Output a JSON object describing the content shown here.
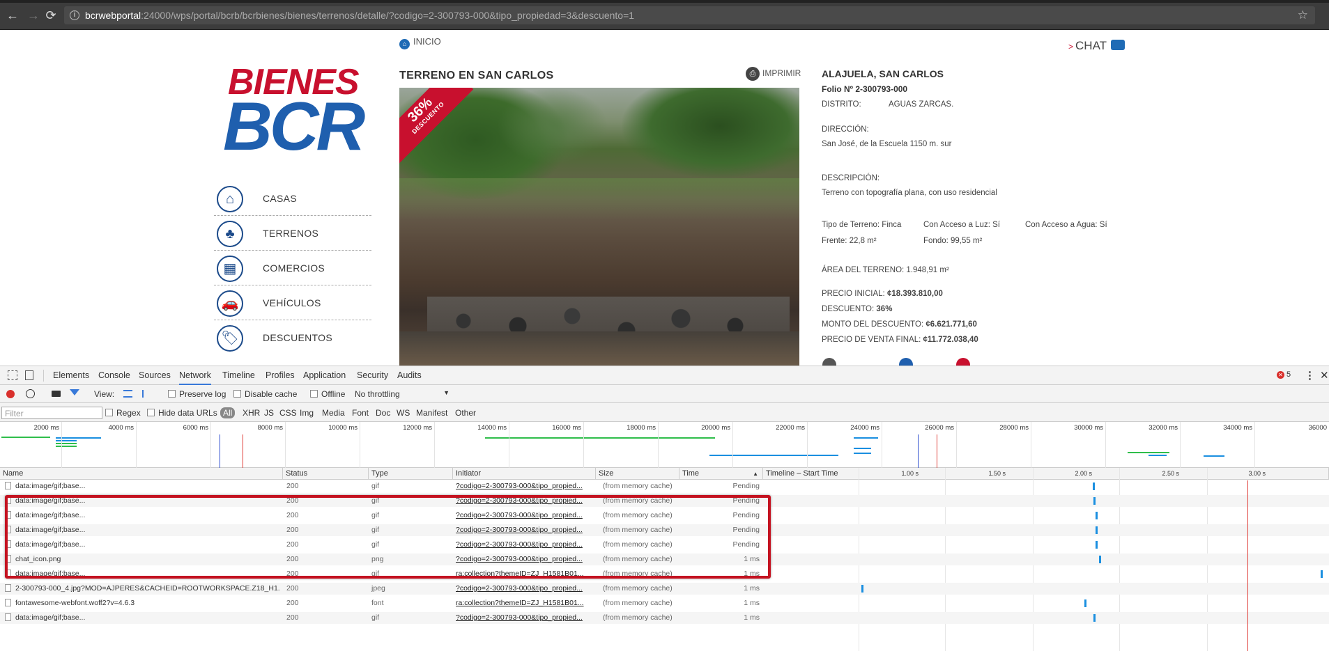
{
  "browser": {
    "url_host": "bcrwebportal",
    "url_rest": ":24000/wps/portal/bcrb/bcrbienes/bienes/terrenos/detalle/?codigo=2-300793-000&tipo_propiedad=3&descuento=1",
    "back": "←",
    "forward": "→",
    "reload": "⟳",
    "info_icon": "i",
    "star": "☆"
  },
  "page": {
    "logo_top": "BIENES",
    "logo_bottom": "BCR",
    "inicio": "INICIO",
    "chat": "CHAT",
    "imprimir": "IMPRIMIR",
    "menu": [
      {
        "label": "CASAS",
        "icon": "⌂"
      },
      {
        "label": "TERRENOS",
        "icon": "♣"
      },
      {
        "label": "COMERCIOS",
        "icon": "▦"
      },
      {
        "label": "VEHÍCULOS",
        "icon": "🚗"
      },
      {
        "label": "DESCUENTOS",
        "icon": "🏷"
      }
    ],
    "property_title": "TERRENO EN SAN CARLOS",
    "ribbon_percent": "36%",
    "ribbon_text": "DESCUENTO",
    "location_title": "ALAJUELA, SAN CARLOS",
    "folio": "Folio Nº 2-300793-000",
    "distrito_label": "DISTRITO:",
    "distrito_value": "AGUAS ZARCAS.",
    "direccion_label": "DIRECCIÓN:",
    "direccion_value": "San José, de la Escuela 1150 m. sur",
    "descripcion_label": "DESCRIPCIÓN:",
    "descripcion_value": "Terreno con topografía plana, con uso residencial",
    "tipo_terreno": "Tipo de Terreno: Finca",
    "acceso_luz": "Con Acceso a Luz: Sí",
    "acceso_agua": "Con Acceso a Agua: Sí",
    "frente": "Frente: 22,8 m²",
    "fondo": "Fondo: 99,55 m²",
    "area": "ÁREA DEL TERRENO: 1.948,91 m²",
    "precio_inicial_label": "PRECIO INICIAL:",
    "precio_inicial_value": "¢18.393.810,00",
    "descuento_label": "DESCUENTO:",
    "descuento_value": "36%",
    "monto_label": "MONTO DEL DESCUENTO:",
    "monto_value": "¢6.621.771,60",
    "precio_final_label": "PRECIO DE VENTA FINAL:",
    "precio_final_value": "¢11.772.038,40"
  },
  "devtools": {
    "tabs": [
      "Elements",
      "Console",
      "Sources",
      "Network",
      "Timeline",
      "Profiles",
      "Application",
      "Security",
      "Audits"
    ],
    "active_tab": "Network",
    "error_count": "5",
    "toolbar": {
      "view": "View:",
      "preserve_log": "Preserve log",
      "disable_cache": "Disable cache",
      "offline": "Offline",
      "throttling": "No throttling"
    },
    "filter_placeholder": "Filter",
    "filter_types": [
      "Regex",
      "Hide data URLs",
      "All",
      "XHR",
      "JS",
      "CSS",
      "Img",
      "Media",
      "Font",
      "Doc",
      "WS",
      "Manifest",
      "Other"
    ],
    "overview_ticks": [
      "2000 ms",
      "4000 ms",
      "6000 ms",
      "8000 ms",
      "10000 ms",
      "12000 ms",
      "14000 ms",
      "16000 ms",
      "18000 ms",
      "20000 ms",
      "22000 ms",
      "24000 ms",
      "26000 ms",
      "28000 ms",
      "30000 ms",
      "32000 ms",
      "34000 ms",
      "36000"
    ],
    "columns": [
      "Name",
      "Status",
      "Type",
      "Initiator",
      "Size",
      "Time",
      "Timeline – Start Time"
    ],
    "timeline_ticks": [
      "1.00 s",
      "1.50 s",
      "2.00 s",
      "2.50 s",
      "3.00 s"
    ],
    "rows": [
      {
        "name": "data:image/gif;base...",
        "status": "200",
        "type": "gif",
        "initiator": "?codigo=2-300793-000&tipo_propied...",
        "size": "(from memory cache)",
        "time": "Pending"
      },
      {
        "name": "data:image/gif;base...",
        "status": "200",
        "type": "gif",
        "initiator": "?codigo=2-300793-000&tipo_propied...",
        "size": "(from memory cache)",
        "time": "Pending"
      },
      {
        "name": "data:image/gif;base...",
        "status": "200",
        "type": "gif",
        "initiator": "?codigo=2-300793-000&tipo_propied...",
        "size": "(from memory cache)",
        "time": "Pending"
      },
      {
        "name": "data:image/gif;base...",
        "status": "200",
        "type": "gif",
        "initiator": "?codigo=2-300793-000&tipo_propied...",
        "size": "(from memory cache)",
        "time": "Pending"
      },
      {
        "name": "data:image/gif;base...",
        "status": "200",
        "type": "gif",
        "initiator": "?codigo=2-300793-000&tipo_propied...",
        "size": "(from memory cache)",
        "time": "Pending"
      },
      {
        "name": "chat_icon.png",
        "status": "200",
        "type": "png",
        "initiator": "?codigo=2-300793-000&tipo_propied...",
        "size": "(from memory cache)",
        "time": "1 ms"
      },
      {
        "name": "data:image/gif;base...",
        "status": "200",
        "type": "gif",
        "initiator": "ra:collection?themeID=ZJ_H1581B01...",
        "size": "(from memory cache)",
        "time": "1 ms"
      },
      {
        "name": "2-300793-000_4.jpg?MOD=AJPERES&CACHEID=ROOTWORKSPACE.Z18_H1...",
        "status": "200",
        "type": "jpeg",
        "initiator": "?codigo=2-300793-000&tipo_propied...",
        "size": "(from memory cache)",
        "time": "1 ms"
      },
      {
        "name": "fontawesome-webfont.woff2?v=4.6.3",
        "status": "200",
        "type": "font",
        "initiator": "ra:collection?themeID=ZJ_H1581B01...",
        "size": "(from memory cache)",
        "time": "1 ms"
      },
      {
        "name": "data:image/gif;base...",
        "status": "200",
        "type": "gif",
        "initiator": "?codigo=2-300793-000&tipo_propied...",
        "size": "(from memory cache)",
        "time": "1 ms"
      }
    ],
    "colors": {
      "accent": "#3879d9",
      "highlight": "#c41220",
      "record": "#d9302c"
    }
  }
}
